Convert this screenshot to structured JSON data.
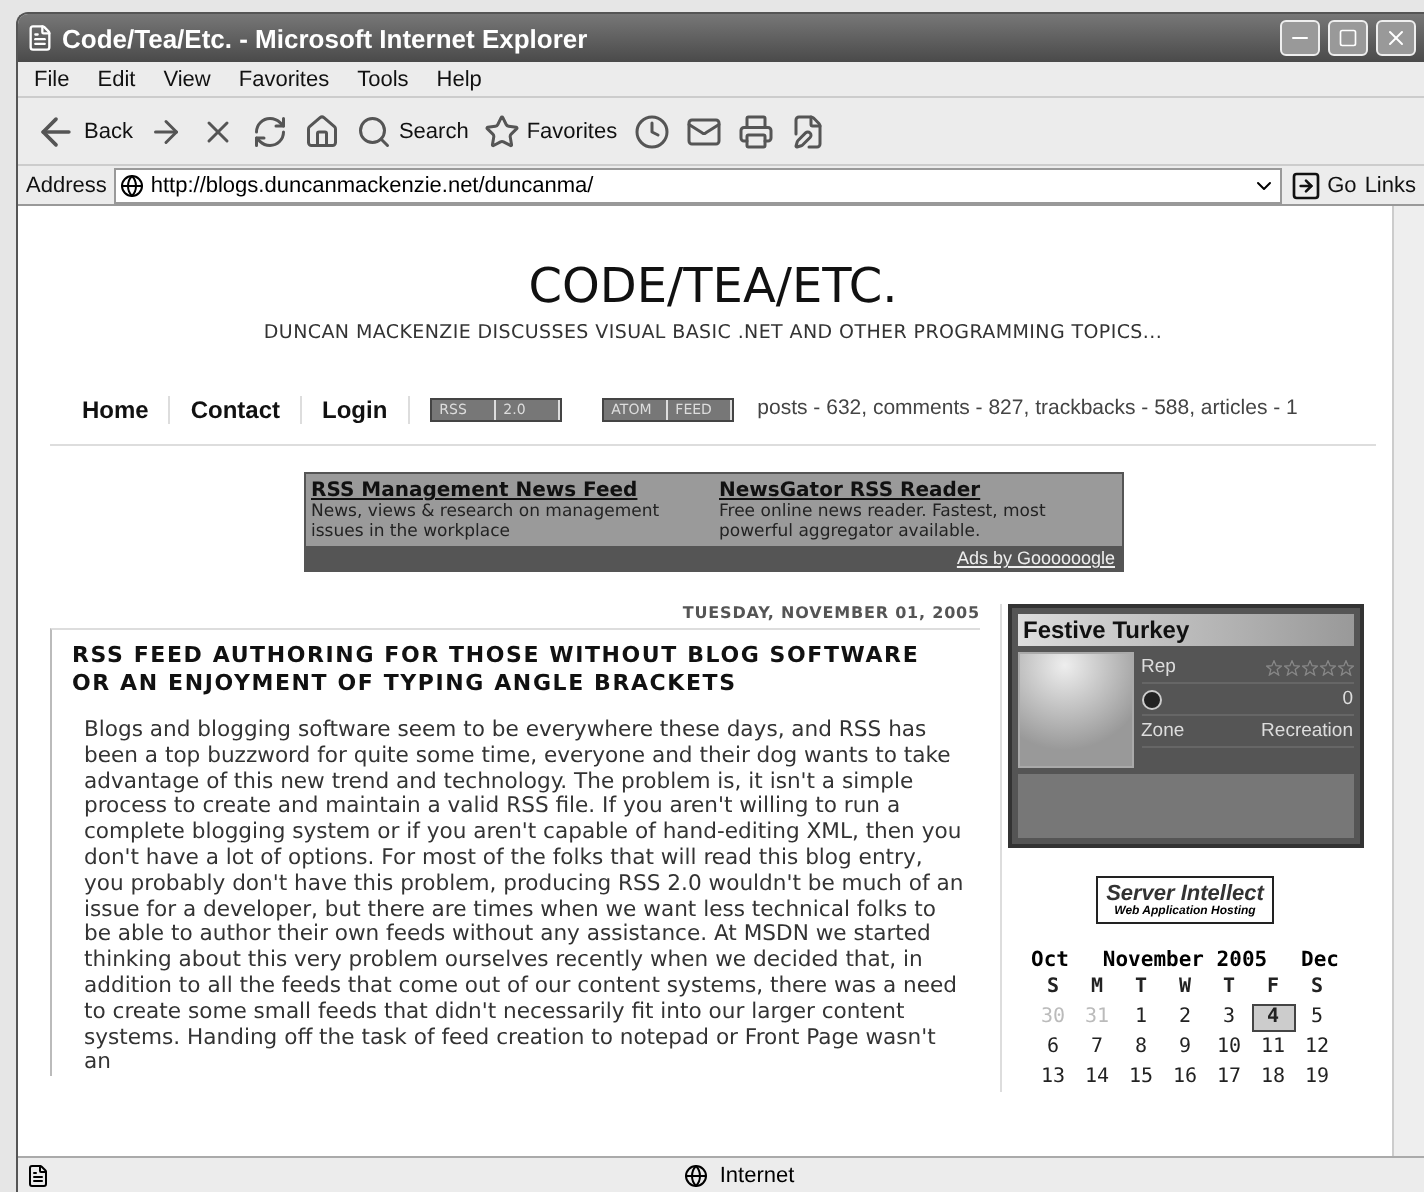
{
  "window": {
    "title": "Code/Tea/Etc. - Microsoft Internet Explorer"
  },
  "menu": [
    "File",
    "Edit",
    "View",
    "Favorites",
    "Tools",
    "Help"
  ],
  "toolbar": [
    {
      "kind": "back",
      "label": "Back"
    },
    {
      "kind": "forward"
    },
    {
      "kind": "stop"
    },
    {
      "kind": "refresh"
    },
    {
      "kind": "home"
    },
    {
      "kind": "search",
      "label": "Search"
    },
    {
      "kind": "favorites",
      "label": "Favorites"
    },
    {
      "kind": "history"
    },
    {
      "kind": "mail"
    },
    {
      "kind": "print"
    },
    {
      "kind": "edit"
    }
  ],
  "address_bar": {
    "label": "Address",
    "value": "http://blogs.duncanmackenzie.net/duncanma/",
    "go": "Go",
    "links": "Links"
  },
  "blog": {
    "title": "CODE/TEA/ETC.",
    "subtitle": "DUNCAN MACKENZIE DISCUSSES VISUAL BASIC .NET AND OTHER PROGRAMMING TOPICS...",
    "nav": [
      "Home",
      "Contact",
      "Login"
    ],
    "feed_badges": [
      [
        "RSS",
        "2.0"
      ],
      [
        "ATOM",
        "FEED"
      ]
    ],
    "stats": "posts - 632, comments - 827, trackbacks - 588, articles - 1"
  },
  "ads": {
    "items": [
      {
        "title": "RSS Management News Feed",
        "text": "News, views & research on management issues in the workplace"
      },
      {
        "title": "NewsGator RSS Reader",
        "text": "Free online news reader. Fastest, most powerful aggregator available."
      }
    ],
    "footer": "Ads by Goooooogle"
  },
  "post": {
    "date": "TUESDAY, NOVEMBER 01, 2005",
    "title": "RSS FEED AUTHORING FOR THOSE WITHOUT BLOG SOFTWARE OR AN ENJOYMENT OF TYPING ANGLE BRACKETS",
    "body": "Blogs and blogging software seem to be everywhere these days, and RSS has been a top buzzword for quite some time, everyone and their dog wants to take advantage of this new trend and technology. The problem is, it isn't a simple process to create and maintain a valid RSS file. If you aren't willing to run a complete blogging system or if you aren't capable of hand-editing XML, then you don't have a lot of options. For most of the folks that will read this blog entry, you probably don't have this problem, producing RSS 2.0 wouldn't be much of an issue for a developer, but there are times when we want less technical folks to be able to author their own feeds without any assistance. At MSDN we started thinking about this very problem ourselves recently when we decided that, in addition to all the feeds that come out of our content systems, there was a need to create some small feeds that didn't necessarily fit into our larger content systems. Handing off the task of feed creation to notepad or Front Page wasn't an"
  },
  "gamercard": {
    "name": "Festive Turkey",
    "rep_label": "Rep",
    "stars": 0,
    "score": "0",
    "zone_label": "Zone",
    "zone": "Recreation"
  },
  "sponsor": {
    "name": "Server Intellect",
    "tagline": "Web Application Hosting"
  },
  "calendar": {
    "prev": "Oct",
    "month": "November 2005",
    "next": "Dec",
    "weekdays": [
      "S",
      "M",
      "T",
      "W",
      "T",
      "F",
      "S"
    ],
    "weeks": [
      [
        {
          "day": "30",
          "muted": true,
          "selected": false
        },
        {
          "day": "31",
          "muted": true,
          "selected": false
        },
        {
          "day": "1",
          "muted": false,
          "selected": false
        },
        {
          "day": "2",
          "muted": false,
          "selected": false
        },
        {
          "day": "3",
          "muted": false,
          "selected": false
        },
        {
          "day": "4",
          "muted": false,
          "selected": true
        },
        {
          "day": "5",
          "muted": false,
          "selected": false
        }
      ],
      [
        {
          "day": "6",
          "muted": false,
          "selected": false
        },
        {
          "day": "7",
          "muted": false,
          "selected": false
        },
        {
          "day": "8",
          "muted": false,
          "selected": false
        },
        {
          "day": "9",
          "muted": false,
          "selected": false
        },
        {
          "day": "10",
          "muted": false,
          "selected": false
        },
        {
          "day": "11",
          "muted": false,
          "selected": false
        },
        {
          "day": "12",
          "muted": false,
          "selected": false
        }
      ],
      [
        {
          "day": "13",
          "muted": false,
          "selected": false
        },
        {
          "day": "14",
          "muted": false,
          "selected": false
        },
        {
          "day": "15",
          "muted": false,
          "selected": false
        },
        {
          "day": "16",
          "muted": false,
          "selected": false
        },
        {
          "day": "17",
          "muted": false,
          "selected": false
        },
        {
          "day": "18",
          "muted": false,
          "selected": false
        },
        {
          "day": "19",
          "muted": false,
          "selected": false
        }
      ]
    ]
  },
  "status_bar": {
    "zone": "Internet"
  }
}
